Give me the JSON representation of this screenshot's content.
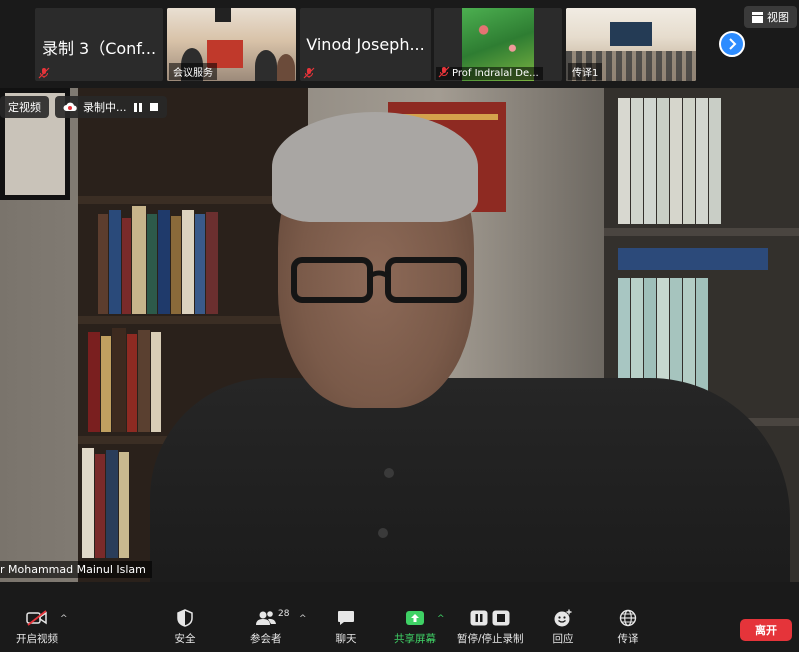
{
  "top_strip": {
    "tiles": [
      {
        "name": "录制 3（Conf...",
        "muted": true
      },
      {
        "label": "会议服务",
        "muted": false
      },
      {
        "name": "Vinod Joseph...",
        "muted": true
      },
      {
        "label": "Prof Indralal De...",
        "muted": true
      },
      {
        "label": "传译1",
        "muted": false
      }
    ],
    "view_label": "视图"
  },
  "main_video": {
    "pin_badge": "定视频",
    "recording_badge": "录制中...",
    "speaker_name": "r Mohammad Mainul Islam"
  },
  "toolbar": {
    "start_video": "开启视频",
    "security": "安全",
    "participants": "参会者",
    "participants_count": "28",
    "chat": "聊天",
    "share_screen": "共享屏幕",
    "pause_stop_recording": "暂停/停止录制",
    "reactions": "回应",
    "interpretation": "传译",
    "leave": "离开"
  },
  "colors": {
    "accent_blue": "#2d8cff",
    "share_green": "#3fd165",
    "leave_red": "#e5343a",
    "muted_red": "#e5343a",
    "recording_red": "#e5343a"
  }
}
